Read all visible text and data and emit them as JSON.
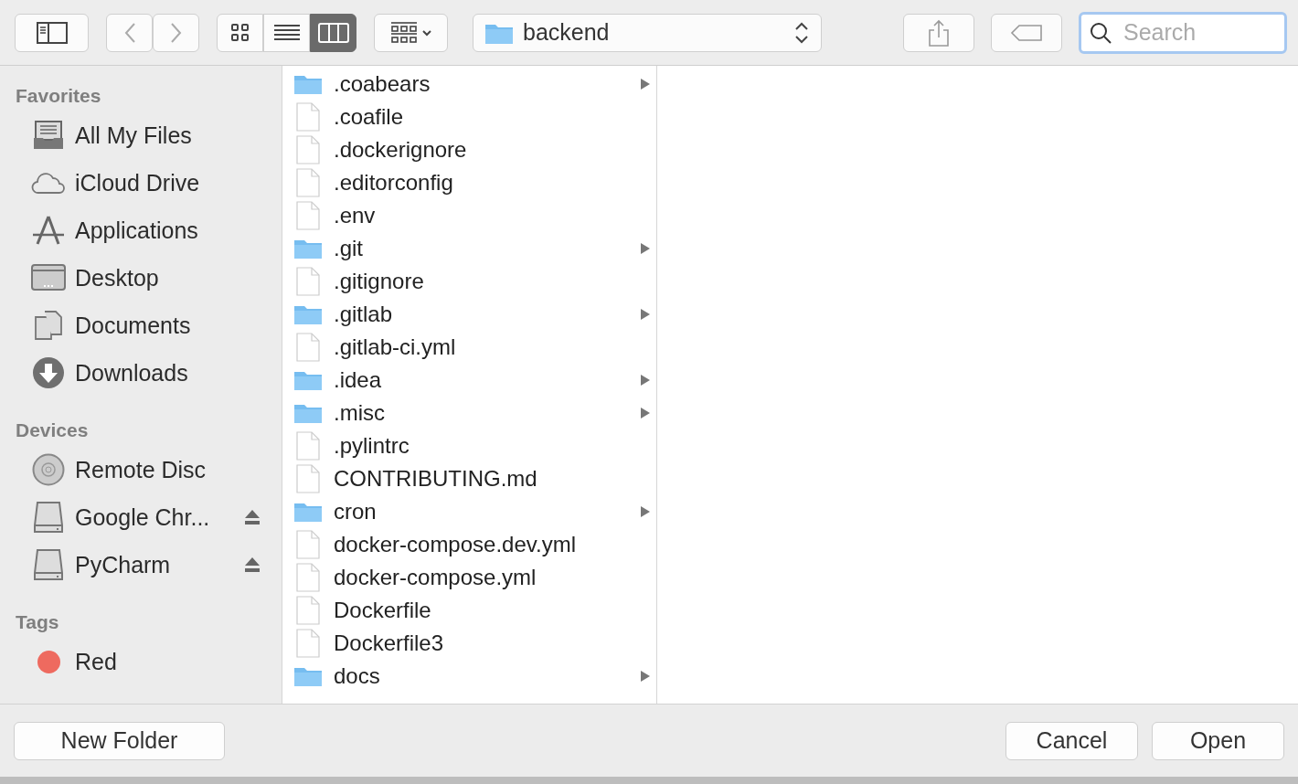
{
  "toolbar": {
    "view_modes": [
      {
        "kind": "icons",
        "selected": false
      },
      {
        "kind": "list",
        "selected": false
      },
      {
        "kind": "columns",
        "selected": true
      }
    ],
    "path": "backend",
    "search": {
      "placeholder": "Search"
    }
  },
  "sidebar": {
    "sections": [
      {
        "title": "Favorites",
        "items": [
          {
            "label": "All My Files",
            "kind": "files"
          },
          {
            "label": "iCloud Drive",
            "kind": "cloud"
          },
          {
            "label": "Applications",
            "kind": "apps"
          },
          {
            "label": "Desktop",
            "kind": "desktop"
          },
          {
            "label": "Documents",
            "kind": "documents"
          },
          {
            "label": "Downloads",
            "kind": "downloads"
          }
        ]
      },
      {
        "title": "Devices",
        "items": [
          {
            "label": "Remote Disc",
            "kind": "disc",
            "ejectable": false
          },
          {
            "label": "Google Chr...",
            "kind": "drive",
            "ejectable": true
          },
          {
            "label": "PyCharm",
            "kind": "drive",
            "ejectable": true
          }
        ]
      },
      {
        "title": "Tags",
        "items": [
          {
            "label": "Red",
            "kind": "tag",
            "color": "#ee6a5f"
          }
        ]
      }
    ]
  },
  "column": {
    "items": [
      {
        "name": ".coabears",
        "kind": "folder"
      },
      {
        "name": ".coafile",
        "kind": "file"
      },
      {
        "name": ".dockerignore",
        "kind": "file"
      },
      {
        "name": ".editorconfig",
        "kind": "file"
      },
      {
        "name": ".env",
        "kind": "file"
      },
      {
        "name": ".git",
        "kind": "folder"
      },
      {
        "name": ".gitignore",
        "kind": "file"
      },
      {
        "name": ".gitlab",
        "kind": "folder"
      },
      {
        "name": ".gitlab-ci.yml",
        "kind": "file"
      },
      {
        "name": ".idea",
        "kind": "folder"
      },
      {
        "name": ".misc",
        "kind": "folder"
      },
      {
        "name": ".pylintrc",
        "kind": "file"
      },
      {
        "name": "CONTRIBUTING.md",
        "kind": "file"
      },
      {
        "name": "cron",
        "kind": "folder"
      },
      {
        "name": "docker-compose.dev.yml",
        "kind": "file"
      },
      {
        "name": "docker-compose.yml",
        "kind": "file"
      },
      {
        "name": "Dockerfile",
        "kind": "file"
      },
      {
        "name": "Dockerfile3",
        "kind": "file"
      },
      {
        "name": "docs",
        "kind": "folder"
      }
    ]
  },
  "footer": {
    "new_folder": "New Folder",
    "cancel": "Cancel",
    "open": "Open"
  }
}
